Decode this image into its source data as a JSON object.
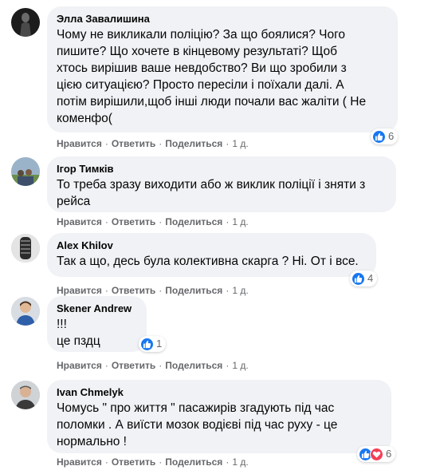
{
  "actions": {
    "like": "Нравится",
    "reply": "Ответить",
    "share": "Поделиться",
    "separator": "·"
  },
  "comments": [
    {
      "author": "Элла Завалишина",
      "text": "Чому не викликали поліцію? За що боялися? Чого\nпишите? Що хочете в кінцевому результаті? Щоб\nхтось вирішив ваше невдобство? Ви що зробили з\nцією ситуацією? Просто пересіли і поїхали далі. А\nпотім вирішили,щоб інші люди почали вас жаліти ( Не\nкоменфо(",
      "reactions": [
        "like"
      ],
      "reaction_count": "6",
      "time": "1 д."
    },
    {
      "author": "Ігор Тимків",
      "text": "То треба зразу виходити або ж виклик поліції і зняти з\nрейса",
      "reactions": [],
      "reaction_count": "",
      "time": "1 д."
    },
    {
      "author": "Alex Khilov",
      "text": "Так а що, десь була колективна скарга ? Ні. От і все.",
      "reactions": [
        "like"
      ],
      "reaction_count": "4",
      "time": "1 д."
    },
    {
      "author": "Skener Andrew",
      "text": "!!!\nце пздц",
      "reactions": [
        "like"
      ],
      "reaction_count": "1",
      "time": "1 д."
    },
    {
      "author": "Ivan Chmelyk",
      "text": "Чомусь \" про життя \" пасажирів згадують під час\nполомки . А виїсти мозок водієві під час руху - це\nнормально !",
      "reactions": [
        "like",
        "love"
      ],
      "reaction_count": "6",
      "time": "1 д."
    }
  ],
  "colors": {
    "bubble": "#f0f2f5",
    "like": "#1877f2",
    "love": "#f33e58",
    "meta_text": "#65676b"
  }
}
